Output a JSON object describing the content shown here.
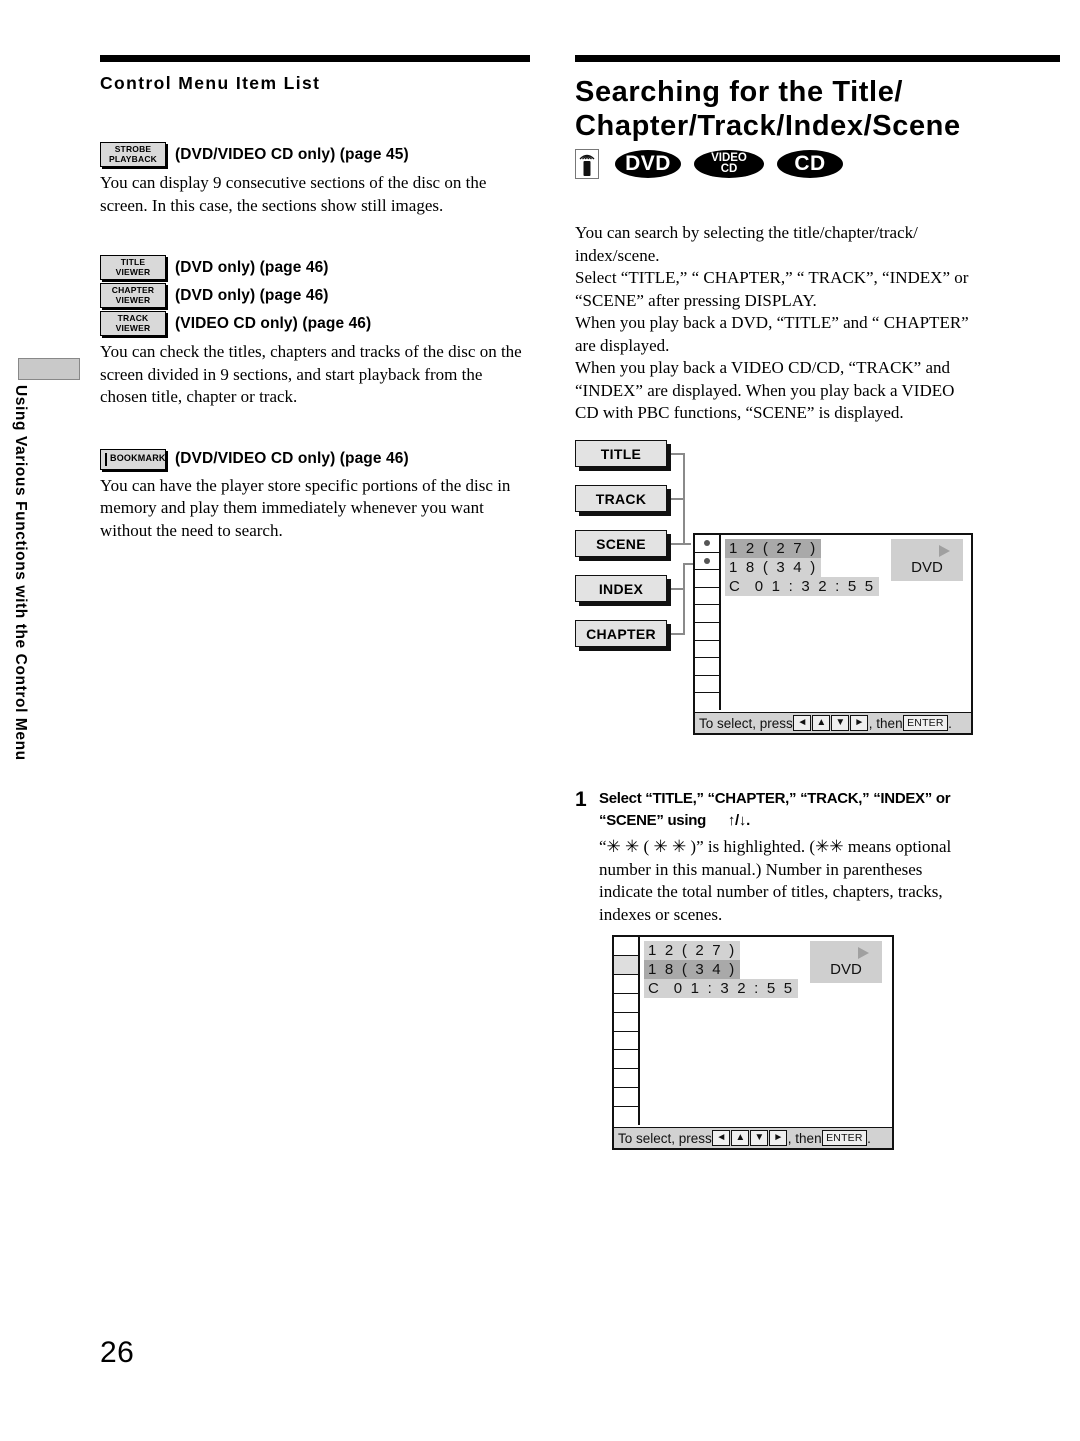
{
  "page_number": "26",
  "side_tab": {
    "label": "Using Various Functions with the Control Menu"
  },
  "left_column": {
    "heading": "Control Menu Item List",
    "items": [
      {
        "badge_line1": "STROBE",
        "badge_line2": "PLAYBACK",
        "title": "(DVD/VIDEO CD only) (page 45)",
        "body": "You can display 9 consecutive sections of the disc on the screen. In this case, the sections show still images."
      },
      {
        "badge_line1": "TITLE",
        "badge_line2": "VIEWER",
        "title": "(DVD only) (page 46)",
        "badge2_line1": "CHAPTER",
        "badge2_line2": "VIEWER",
        "title2": "(DVD only) (page 46)",
        "badge3_line1": "TRACK",
        "badge3_line2": "VIEWER",
        "title3": "(VIDEO CD only) (page 46)",
        "body": "You can check the titles, chapters and tracks of the disc on the screen divided in 9 sections, and start playback from the chosen title, chapter or track."
      },
      {
        "badge_line1": "BOOKMARK",
        "title": "(DVD/VIDEO CD only) (page 46)",
        "body": "You can have the player store specific portions of the disc in memory and play them immediately whenever you want without the need to search."
      }
    ]
  },
  "right_column": {
    "title_line1": "Searching for the Title/",
    "title_line2": "Chapter/Track/Index/Scene",
    "disc_badges": [
      {
        "name": "remote-icon",
        "label": ""
      },
      {
        "name": "dvd-badge",
        "label": "DVD"
      },
      {
        "name": "video-cd-badge",
        "label_line1": "VIDEO",
        "label_line2": "CD"
      },
      {
        "name": "cd-badge",
        "label": "CD"
      }
    ],
    "intro_paragraph": "You can search by selecting the title/chapter/track/ index/scene. Select “TITLE,” “ CHAPTER,” “ TRACK”, “INDEX” or “SCENE” after pressing DISPLAY. When you play back a DVD, “TITLE” and “ CHAPTER” are displayed. When you play back a VIDEO CD/CD, “TRACK” and “INDEX” are displayed.  When you play back a VIDEO CD with PBC functions, “SCENE” is displayed.",
    "intro_lines": [
      "You can search by selecting the title/chapter/track/",
      "index/scene.",
      "Select “TITLE,” “ CHAPTER,” “ TRACK”, “INDEX” or",
      "“SCENE” after pressing DISPLAY.",
      "When you play back a DVD,  “TITLE” and “ CHAPTER”",
      "are displayed.",
      "When you play back a VIDEO CD/CD,  “TRACK” and",
      "“INDEX” are displayed.  When you play back a VIDEO",
      "CD with PBC functions, “SCENE” is displayed."
    ]
  },
  "diagram1": {
    "buttons": [
      "TITLE",
      "TRACK",
      "SCENE",
      "INDEX",
      "CHAPTER"
    ],
    "osd": {
      "row1": "1 2 ( 2 7 )",
      "row2": "1 8 ( 3 4 )",
      "row3": "C  0 1 : 3 2 : 5 5",
      "highlighted_row": 1,
      "disc_label": "DVD",
      "play_icon": "play-triangle-icon"
    },
    "footer": {
      "prefix": "To select, press ",
      "keys": [
        "◄",
        "▲",
        "▼",
        "►"
      ],
      "middle": ", then ",
      "enter_key": "ENTER",
      "suffix": "."
    }
  },
  "step1": {
    "number": "1",
    "head_line1": "Select “TITLE,” “CHAPTER,” “TRACK,” “INDEX” or",
    "head_line2": "“SCENE” using",
    "head_keys": "↑/↓.",
    "body_lines": [
      "“✳ ✳ ( ✳ ✳ )” is highlighted.  (✳✳ means optional",
      "number in this manual.)  Number in parentheses",
      "indicate the total number of titles, chapters, tracks,",
      "indexes or scenes."
    ]
  },
  "diagram2": {
    "osd": {
      "row1": "1 2 ( 2 7 )",
      "row2": "1 8 ( 3 4 )",
      "row3": "C  0 1 : 3 2 : 5 5",
      "highlighted_row": 2,
      "disc_label": "DVD",
      "play_icon": "play-triangle-icon"
    },
    "footer": {
      "prefix": "To select, press ",
      "keys": [
        "◄",
        "▲",
        "▼",
        "►"
      ],
      "middle": ", then ",
      "enter_key": "ENTER",
      "suffix": "."
    }
  },
  "colors": {
    "badge_fill": "#d9d9d9",
    "osd_row": "#d2d2d2",
    "osd_row_highlight": "#a9a9a9",
    "button_fill": "#e3e3e3"
  }
}
